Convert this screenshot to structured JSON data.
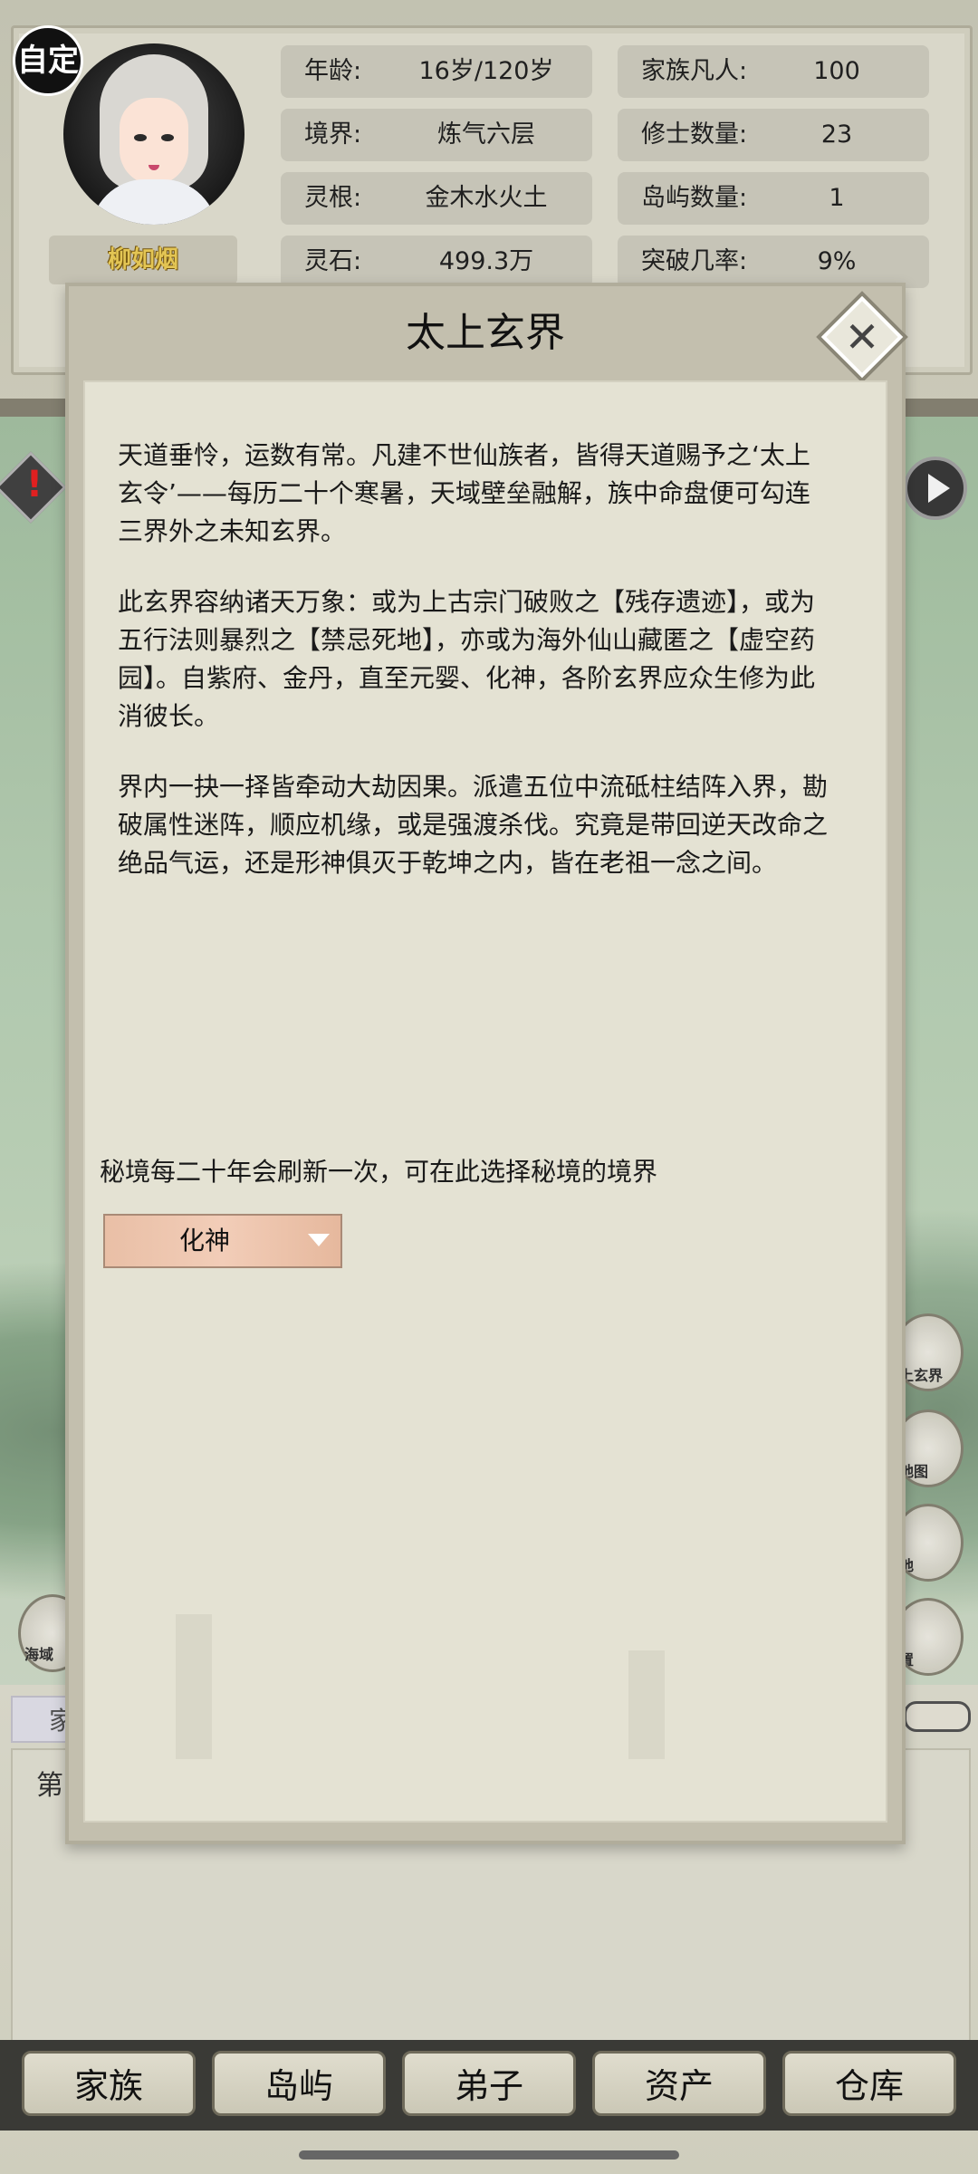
{
  "header": {
    "custom_badge": "自定",
    "character_name": "柳如烟",
    "stats_left": [
      {
        "label": "年龄:",
        "value": "16岁/120岁"
      },
      {
        "label": "境界:",
        "value": "炼气六层"
      },
      {
        "label": "灵根:",
        "value": "金木水火土"
      },
      {
        "label": "灵石:",
        "value": "499.3万"
      }
    ],
    "stats_right": [
      {
        "label": "家族凡人:",
        "value": "100"
      },
      {
        "label": "修士数量:",
        "value": "23"
      },
      {
        "label": "岛屿数量:",
        "value": "1"
      },
      {
        "label": "突破几率:",
        "value": "9%"
      }
    ]
  },
  "side_menu": {
    "right": [
      "上玄界",
      "地图",
      "地",
      "置"
    ],
    "left": "海域",
    "tab_partial": "家",
    "log_partial": "第"
  },
  "modal": {
    "title": "太上玄界",
    "paragraphs": [
      "天道垂怜，运数有常。凡建不世仙族者，皆得天道赐予之‘太上\n玄令’——每历二十个寒暑，天域壁垒融解，族中命盘便可勾连\n三界外之未知玄界。",
      "此玄界容纳诸天万象：或为上古宗门破败之【残存遗迹】，或为\n五行法则暴烈之【禁忌死地】，亦或为海外仙山藏匿之【虚空药\n园】。自紫府、金丹，直至元婴、化神，各阶玄界应众生修为此\n消彼长。",
      "界内一抉一择皆牵动大劫因果。派遣五位中流砥柱结阵入界，勘\n破属性迷阵，顺应机缘，或是强渡杀伐。究竟是带回逆天改命之\n绝品气运，还是形神俱灭于乾坤之内，皆在老祖一念之间。"
    ],
    "refresh_note": "秘境每二十年会刷新一次，可在此选择秘境的境界",
    "realm_select": {
      "selected": "化神"
    }
  },
  "bottom_nav": [
    "家族",
    "岛屿",
    "弟子",
    "资产",
    "仓库"
  ],
  "colors": {
    "name_gold": "#f2d25a",
    "select_bg": "#f2cdb8"
  }
}
